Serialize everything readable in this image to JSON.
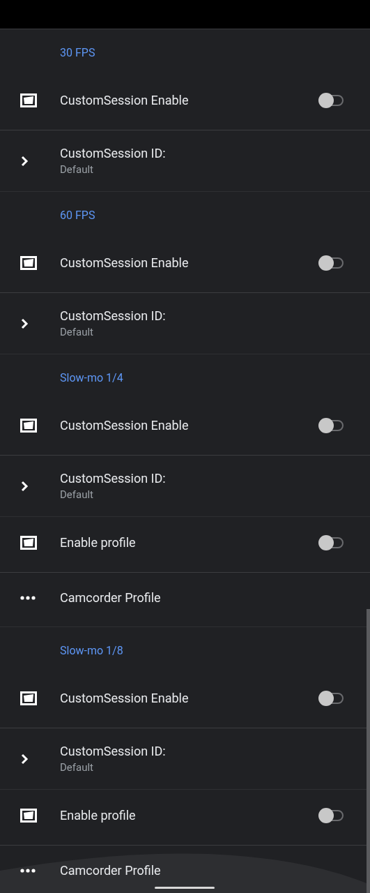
{
  "sections": [
    {
      "header": "30 FPS",
      "items": [
        {
          "kind": "toggle",
          "title": "CustomSession Enable",
          "on": false
        },
        {
          "kind": "link",
          "title": "CustomSession ID:",
          "summary": "Default"
        }
      ]
    },
    {
      "header": "60 FPS",
      "items": [
        {
          "kind": "toggle",
          "title": "CustomSession Enable",
          "on": false
        },
        {
          "kind": "link",
          "title": "CustomSession ID:",
          "summary": "Default"
        }
      ]
    },
    {
      "header": "Slow-mo 1/4",
      "items": [
        {
          "kind": "toggle",
          "title": "CustomSession Enable",
          "on": false
        },
        {
          "kind": "link",
          "title": "CustomSession ID:",
          "summary": "Default"
        },
        {
          "kind": "toggle",
          "title": "Enable profile",
          "on": false
        },
        {
          "kind": "more",
          "title": "Camcorder Profile"
        }
      ]
    },
    {
      "header": "Slow-mo 1/8",
      "items": [
        {
          "kind": "toggle",
          "title": "CustomSession Enable",
          "on": false
        },
        {
          "kind": "link",
          "title": "CustomSession ID:",
          "summary": "Default"
        },
        {
          "kind": "toggle",
          "title": "Enable profile",
          "on": false
        },
        {
          "kind": "more",
          "title": "Camcorder Profile"
        }
      ]
    }
  ]
}
